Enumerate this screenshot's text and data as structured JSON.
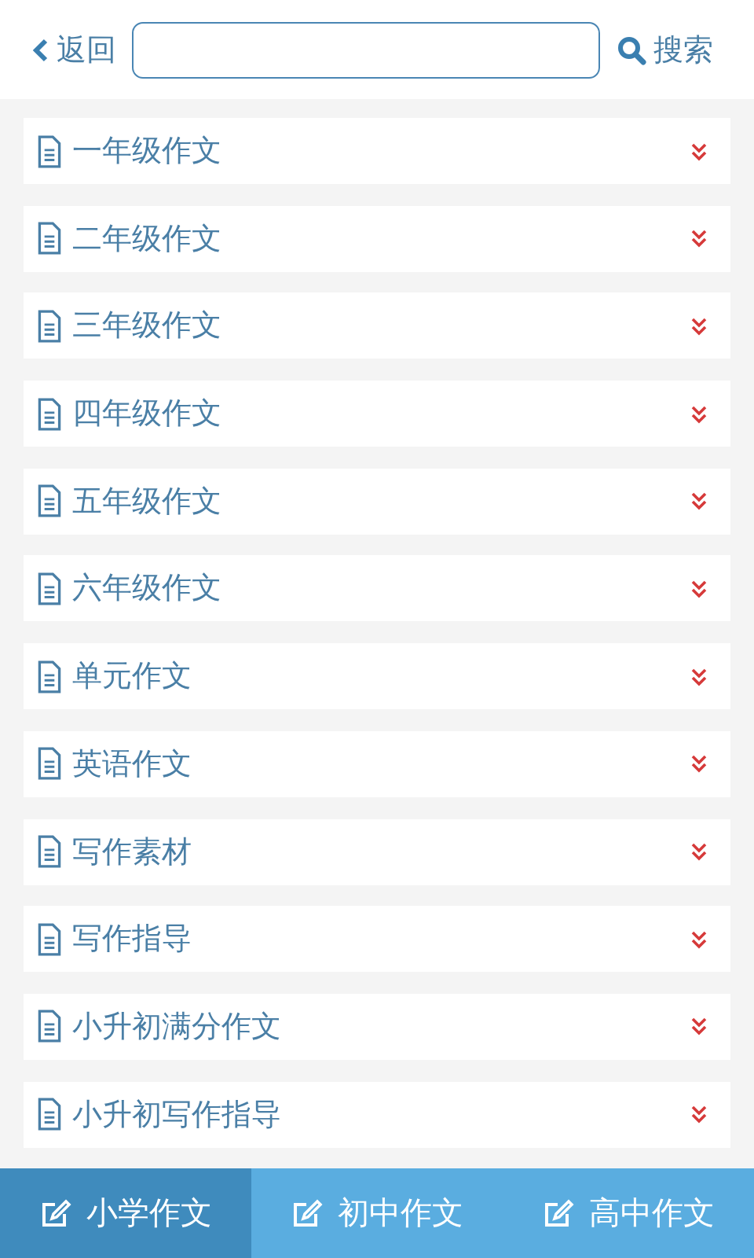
{
  "header": {
    "back": "返回",
    "search_label": "搜索"
  },
  "categories": [
    {
      "label": "一年级作文",
      "expanded": false
    },
    {
      "label": "二年级作文",
      "expanded": false
    },
    {
      "label": "三年级作文",
      "expanded": false
    },
    {
      "label": "四年级作文",
      "expanded": false
    },
    {
      "label": "五年级作文",
      "expanded": false
    },
    {
      "label": "六年级作文",
      "expanded": false
    },
    {
      "label": "单元作文",
      "expanded": false
    },
    {
      "label": "英语作文",
      "expanded": false
    },
    {
      "label": "写作素材",
      "expanded": false
    },
    {
      "label": "写作指导",
      "expanded": false
    },
    {
      "label": "小升初满分作文",
      "expanded": false
    },
    {
      "label": "小升初写作指导",
      "expanded": false
    }
  ],
  "tabs": [
    {
      "label": "小学作文",
      "selected": true
    },
    {
      "label": "初中作文",
      "selected": false
    },
    {
      "label": "高中作文",
      "selected": false
    }
  ]
}
